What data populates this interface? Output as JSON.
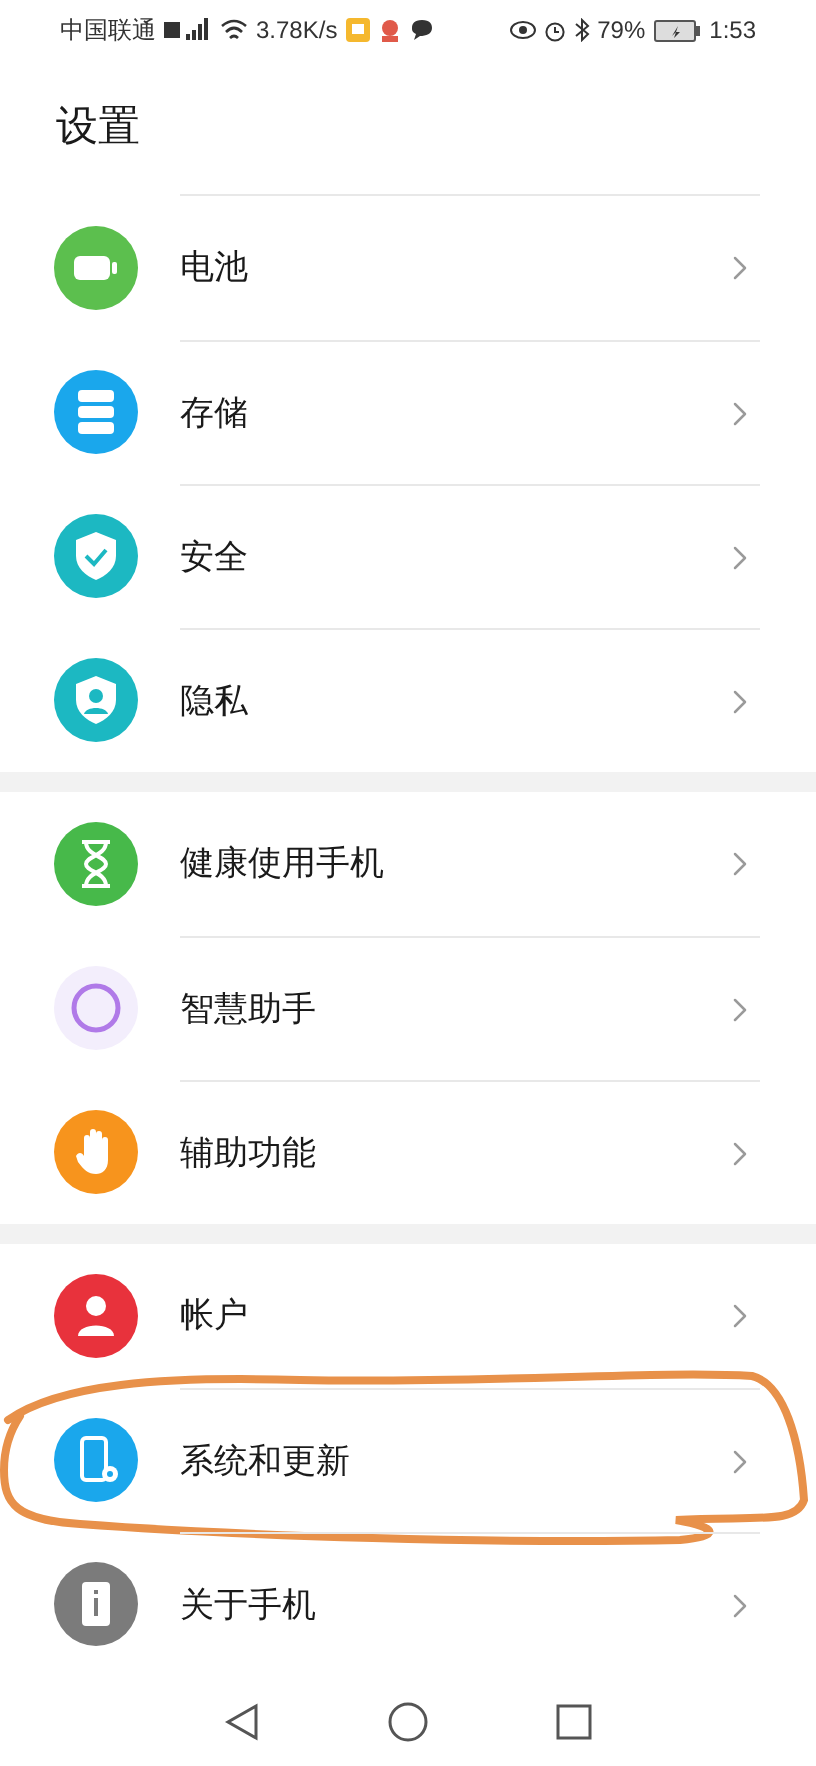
{
  "status_bar": {
    "carrier": "中国联通",
    "speed": "3.78K/s",
    "battery": "79%",
    "time": "1:53"
  },
  "title": "设置",
  "groups": [
    {
      "items": [
        {
          "label": "电池",
          "kind": "battery",
          "color": "#5cbf4e",
          "circled": false
        },
        {
          "label": "存储",
          "kind": "storage",
          "color": "#1aa7ec",
          "circled": false
        },
        {
          "label": "安全",
          "kind": "shield",
          "color": "#1cb8c2",
          "circled": false
        },
        {
          "label": "隐私",
          "kind": "privacy",
          "color": "#1cb8c2",
          "circled": false
        }
      ]
    },
    {
      "items": [
        {
          "label": "健康使用手机",
          "kind": "hourglass",
          "color": "#47b94a",
          "circled": false
        },
        {
          "label": "智慧助手",
          "kind": "assistant",
          "color": "#b07ae8",
          "circled": false
        },
        {
          "label": "辅助功能",
          "kind": "hand",
          "color": "#f7941d",
          "circled": false
        }
      ]
    },
    {
      "items": [
        {
          "label": "帐户",
          "kind": "account",
          "color": "#e8323c",
          "circled": false
        },
        {
          "label": "系统和更新",
          "kind": "system",
          "color": "#1aa7ec",
          "circled": true
        },
        {
          "label": "关于手机",
          "kind": "about",
          "color": "#7b7b7b",
          "circled": false
        }
      ]
    }
  ]
}
